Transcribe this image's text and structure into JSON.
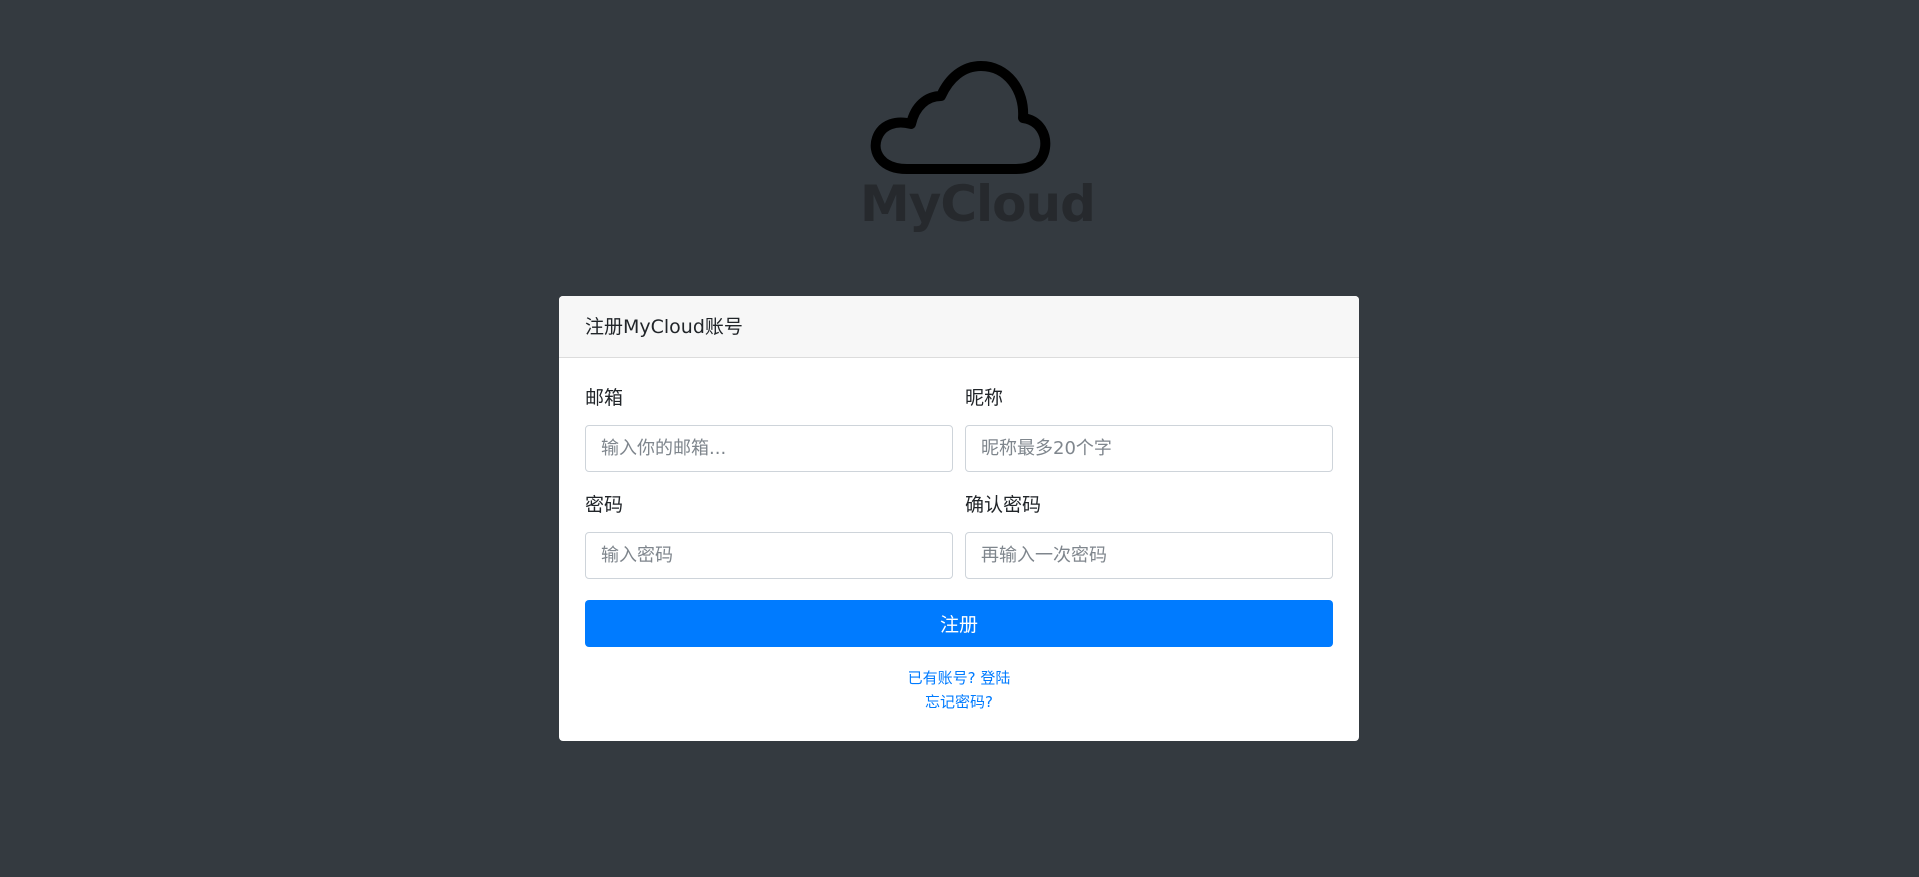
{
  "logo": {
    "icon": "cloud-icon",
    "text": "MyCloud"
  },
  "card": {
    "title": "注册MyCloud账号",
    "email": {
      "label": "邮箱",
      "placeholder": "输入你的邮箱..."
    },
    "nickname": {
      "label": "昵称",
      "placeholder": "昵称最多20个字"
    },
    "password": {
      "label": "密码",
      "placeholder": "输入密码"
    },
    "confirm_password": {
      "label": "确认密码",
      "placeholder": "再输入一次密码"
    },
    "submit_label": "注册",
    "login_link": "已有账号? 登陆",
    "forgot_link": "忘记密码?"
  },
  "colors": {
    "background": "#343a40",
    "primary": "#007bff",
    "card": "#ffffff",
    "card_header": "#f7f7f7"
  }
}
